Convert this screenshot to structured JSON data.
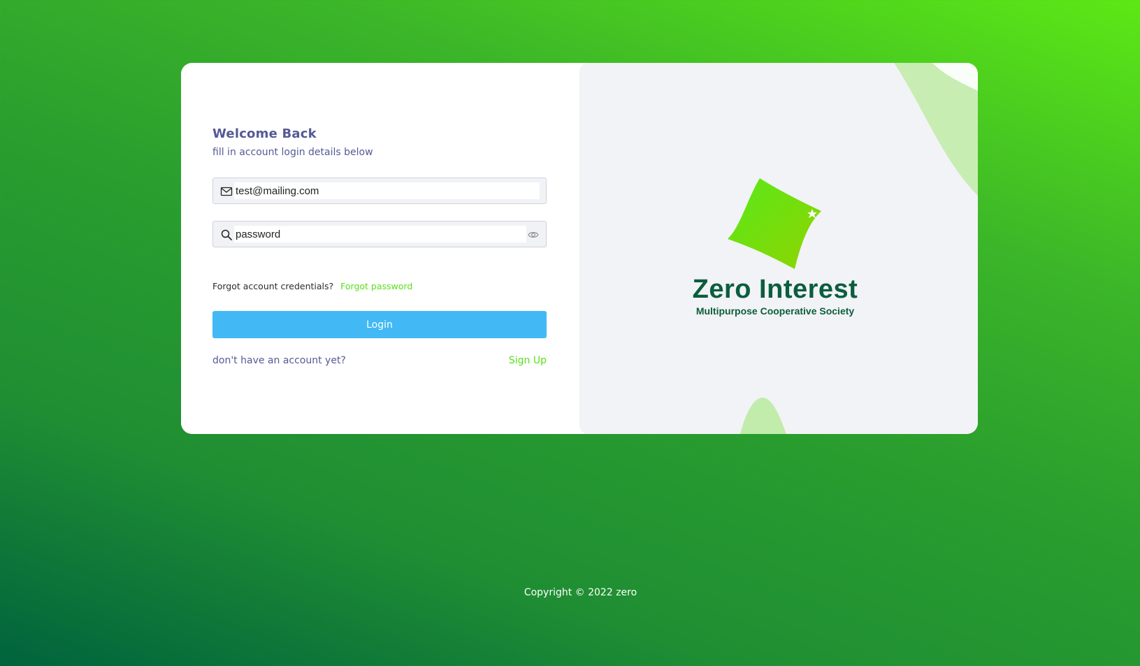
{
  "login": {
    "heading": "Welcome Back",
    "subheading": "fill in account login details below",
    "email": {
      "value": "test@mailing.com",
      "placeholder": ""
    },
    "password": {
      "value": "password",
      "placeholder": ""
    },
    "forgot_question": "Forgot account credentials?",
    "forgot_link": "Forgot password",
    "login_button": "Login",
    "signup_question": "don't have an account yet?",
    "signup_link": "Sign Up"
  },
  "brand": {
    "name": "Zero Interest",
    "tagline": "Multipurpose Cooperative Society"
  },
  "footer": {
    "copyright": "Copyright © 2022 zero"
  },
  "icons": {
    "email": "mail-icon",
    "password": "search-icon",
    "toggle": "eye-icon"
  },
  "colors": {
    "accent_green": "#59e01b",
    "login_button": "#42b9f5",
    "heading_text": "#545a95",
    "brand_text": "#0b5e3d"
  }
}
